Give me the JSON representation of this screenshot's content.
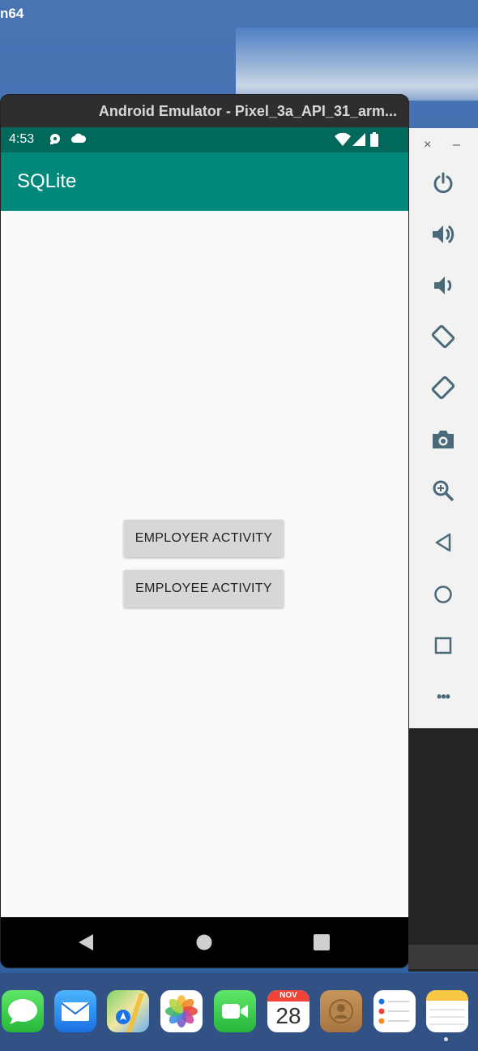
{
  "desktop": {
    "menubar_title": "n64"
  },
  "emulator": {
    "window_title": "Android Emulator - Pixel_3a_API_31_arm...",
    "status": {
      "time": "4:53"
    },
    "app": {
      "title": "SQLite",
      "buttons": {
        "employer": "EMPLOYER ACTIVITY",
        "employee": "EMPLOYEE ACTIVITY"
      }
    }
  },
  "sidebar": {
    "close_label": "×",
    "minimize_label": "–",
    "more_label": "•••"
  },
  "dock": {
    "calendar_month": "NOV",
    "calendar_day": "28"
  },
  "colors": {
    "status_bar": "#00695c",
    "app_bar": "#00897b",
    "button_bg": "#d6d7d7",
    "sidebar_icon": "#4a6a7a"
  }
}
